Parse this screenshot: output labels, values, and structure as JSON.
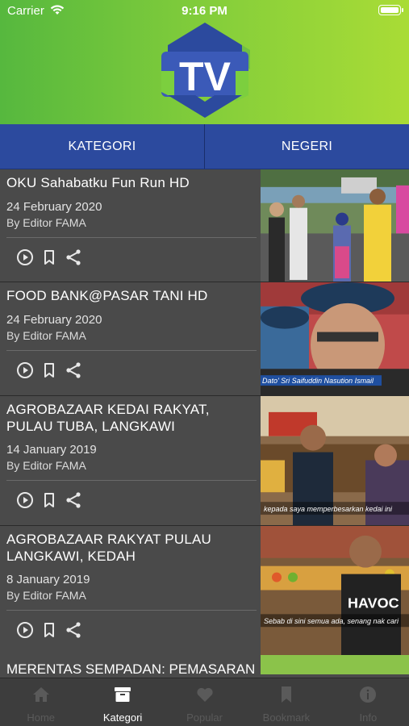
{
  "status_bar": {
    "carrier": "Carrier",
    "time": "9:16 PM"
  },
  "logo": {
    "text": "TV"
  },
  "tabs": [
    {
      "label": "KATEGORI"
    },
    {
      "label": "NEGERI"
    }
  ],
  "videos": [
    {
      "title": "OKU Sahabatku Fun Run HD",
      "date": "24 February 2020",
      "author": "By Editor FAMA"
    },
    {
      "title": "FOOD BANK@PASAR TANI HD",
      "date": "24 February 2020",
      "author": "By Editor FAMA",
      "caption": "Dato' Sri Saifuddin Nasution Ismail"
    },
    {
      "title": "AGROBAZAAR KEDAI RAKYAT, PULAU TUBA, LANGKAWI",
      "date": "14 January 2019",
      "author": "By Editor FAMA",
      "caption": "kepada saya memperbesarkan kedai ini"
    },
    {
      "title": "AGROBAZAAR RAKYAT PULAU LANGKAWI, KEDAH",
      "date": "8 January 2019",
      "author": "By Editor FAMA",
      "caption": "Sebab di sini semua ada, senang nak cari"
    },
    {
      "title": "MERENTAS SEMPADAN: PEMASARAN"
    }
  ],
  "tab_bar": [
    {
      "label": "Home",
      "icon": "home-icon"
    },
    {
      "label": "Kategori",
      "icon": "archive-icon",
      "active": true
    },
    {
      "label": "Popular",
      "icon": "heart-icon"
    },
    {
      "label": "Bookmark",
      "icon": "bookmark-icon"
    },
    {
      "label": "Info",
      "icon": "info-icon"
    }
  ]
}
